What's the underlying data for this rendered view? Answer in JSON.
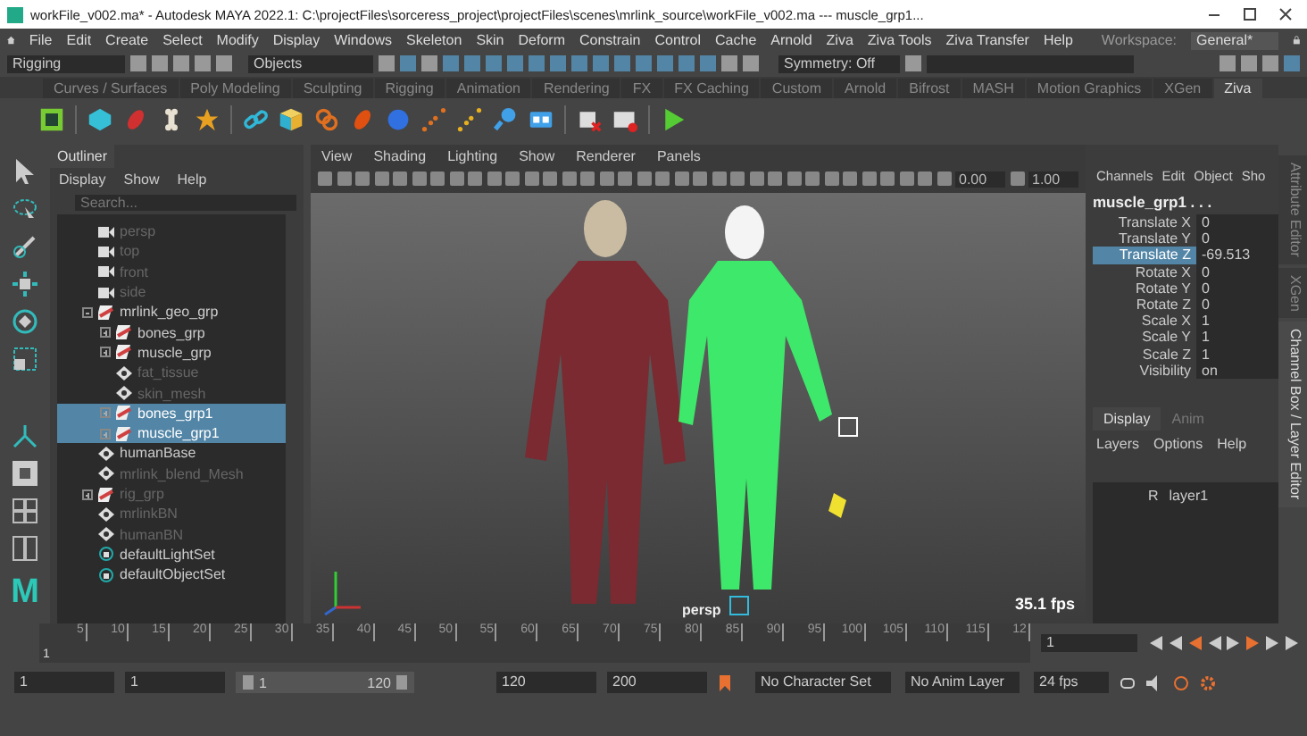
{
  "window": {
    "title": "workFile_v002.ma* - Autodesk MAYA 2022.1: C:\\projectFiles\\sorceress_project\\projectFiles\\scenes\\mrlink_source\\workFile_v002.ma  ---  muscle_grp1..."
  },
  "menu_bar": [
    "File",
    "Edit",
    "Create",
    "Select",
    "Modify",
    "Display",
    "Windows",
    "Skeleton",
    "Skin",
    "Deform",
    "Constrain",
    "Control",
    "Cache",
    "Arnold",
    "Ziva",
    "Ziva Tools",
    "Ziva Transfer",
    "Help"
  ],
  "workspace": {
    "label": "Workspace:",
    "value": "General*"
  },
  "status_line": {
    "menu_set": "Rigging",
    "selection_mode": "Objects",
    "symmetry": "Symmetry: Off"
  },
  "shelf_tabs": [
    {
      "label": "Curves / Surfaces",
      "selected": false
    },
    {
      "label": "Poly Modeling",
      "selected": false
    },
    {
      "label": "Sculpting",
      "selected": false
    },
    {
      "label": "Rigging",
      "selected": false
    },
    {
      "label": "Animation",
      "selected": false
    },
    {
      "label": "Rendering",
      "selected": false
    },
    {
      "label": "FX",
      "selected": false
    },
    {
      "label": "FX Caching",
      "selected": false
    },
    {
      "label": "Custom",
      "selected": false
    },
    {
      "label": "Arnold",
      "selected": false
    },
    {
      "label": "Bifrost",
      "selected": false
    },
    {
      "label": "MASH",
      "selected": false
    },
    {
      "label": "Motion Graphics",
      "selected": false
    },
    {
      "label": "XGen",
      "selected": false
    },
    {
      "label": "Ziva",
      "selected": true
    }
  ],
  "toolbox": {
    "logo": "M"
  },
  "outliner": {
    "title": "Outliner",
    "menus": [
      "Display",
      "Show",
      "Help"
    ],
    "search_placeholder": "Search...",
    "items": [
      {
        "name": "persp",
        "kind": "camera",
        "hidden": true,
        "selected": false
      },
      {
        "name": "top",
        "kind": "camera",
        "hidden": true,
        "selected": false
      },
      {
        "name": "front",
        "kind": "camera",
        "hidden": true,
        "selected": false
      },
      {
        "name": "side",
        "kind": "camera",
        "hidden": true,
        "selected": false
      },
      {
        "name": "mrlink_geo_grp",
        "kind": "group",
        "hidden": false,
        "selected": false,
        "expanded": true,
        "children": [
          {
            "name": "bones_grp",
            "kind": "group",
            "hidden": false,
            "selected": false,
            "expanded": false
          },
          {
            "name": "muscle_grp",
            "kind": "group",
            "hidden": false,
            "selected": false,
            "expanded": false
          },
          {
            "name": "fat_tissue",
            "kind": "mesh",
            "hidden": true,
            "selected": false
          },
          {
            "name": "skin_mesh",
            "kind": "mesh",
            "hidden": true,
            "selected": false
          },
          {
            "name": "bones_grp1",
            "kind": "group",
            "hidden": false,
            "selected": true,
            "expanded": false
          },
          {
            "name": "muscle_grp1",
            "kind": "group",
            "hidden": false,
            "selected": true,
            "expanded": false
          }
        ]
      },
      {
        "name": "humanBase",
        "kind": "mesh",
        "hidden": false,
        "selected": false
      },
      {
        "name": "mrlink_blend_Mesh",
        "kind": "mesh",
        "hidden": true,
        "selected": false
      },
      {
        "name": "rig_grp",
        "kind": "group",
        "hidden": true,
        "selected": false,
        "expanded": false
      },
      {
        "name": "mrlinkBN",
        "kind": "mesh",
        "hidden": true,
        "selected": false
      },
      {
        "name": "humanBN",
        "kind": "mesh",
        "hidden": true,
        "selected": false
      },
      {
        "name": "defaultLightSet",
        "kind": "set",
        "hidden": false,
        "selected": false
      },
      {
        "name": "defaultObjectSet",
        "kind": "set",
        "hidden": false,
        "selected": false
      }
    ]
  },
  "viewport": {
    "menus": [
      "View",
      "Shading",
      "Lighting",
      "Show",
      "Renderer",
      "Panels"
    ],
    "exposure": "0.00",
    "gamma": "1.00",
    "camera": "persp",
    "fps": "35.1 fps"
  },
  "channel_box": {
    "tabs": [
      "Channels",
      "Edit",
      "Object",
      "Sho"
    ],
    "object": "muscle_grp1 . . .",
    "channels": [
      {
        "name": "Translate X",
        "value": "0",
        "selected": false
      },
      {
        "name": "Translate Y",
        "value": "0",
        "selected": false
      },
      {
        "name": "Translate Z",
        "value": "-69.513",
        "selected": true
      },
      {
        "name": "Rotate X",
        "value": "0",
        "selected": false
      },
      {
        "name": "Rotate Y",
        "value": "0",
        "selected": false
      },
      {
        "name": "Rotate Z",
        "value": "0",
        "selected": false
      },
      {
        "name": "Scale X",
        "value": "1",
        "selected": false
      },
      {
        "name": "Scale Y",
        "value": "1",
        "selected": false
      },
      {
        "name": "Scale Z",
        "value": "1",
        "selected": false
      },
      {
        "name": "Visibility",
        "value": "on",
        "selected": false
      }
    ],
    "layer_tabs": [
      {
        "label": "Display",
        "selected": true
      },
      {
        "label": "Anim",
        "selected": false
      }
    ],
    "layer_menus": [
      "Layers",
      "Options",
      "Help"
    ],
    "layers": [
      {
        "flag": "R",
        "name": "layer1"
      }
    ]
  },
  "side_tabs": [
    {
      "label": "Attribute Editor",
      "selected": false
    },
    {
      "label": "XGen",
      "selected": false
    },
    {
      "label": "Channel Box / Layer Editor",
      "selected": true
    }
  ],
  "time_slider": {
    "marker": "1",
    "ticks": [
      "5",
      "10",
      "15",
      "20",
      "25",
      "30",
      "35",
      "40",
      "45",
      "50",
      "55",
      "60",
      "65",
      "70",
      "75",
      "80",
      "85",
      "90",
      "95",
      "100",
      "105",
      "110",
      "115",
      "12"
    ],
    "current_frame": "1"
  },
  "range_slider": {
    "start": "1",
    "playback_start": "1",
    "range_start": "1",
    "range_end": "120",
    "playback_end": "120",
    "end": "200",
    "character_set": "No Character Set",
    "anim_layer": "No Anim Layer",
    "fps": "24 fps"
  }
}
